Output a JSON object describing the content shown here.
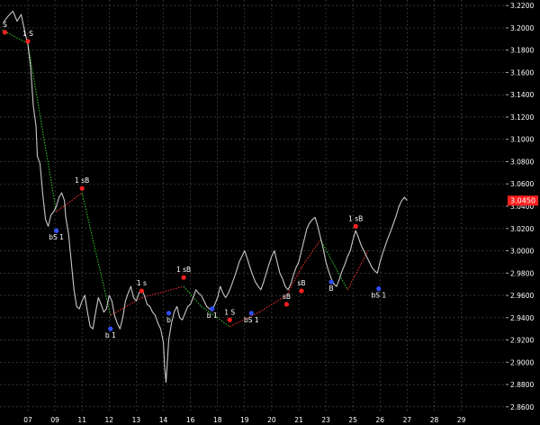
{
  "chart_data": {
    "type": "line",
    "title": "",
    "xlabel": "",
    "ylabel": "",
    "ylim": [
      2.855,
      3.225
    ],
    "y_ticks": [
      "3.2200",
      "3.2000",
      "3.1800",
      "3.1600",
      "3.1400",
      "3.1200",
      "3.1000",
      "3.0800",
      "3.0600",
      "3.0400",
      "3.0200",
      "3.0000",
      "2.9800",
      "2.9600",
      "2.9400",
      "2.9200",
      "2.9000",
      "2.8800",
      "2.8600"
    ],
    "x_ticks": [
      "07",
      "09",
      "11",
      "12",
      "13",
      "14",
      "16",
      "18",
      "19",
      "20",
      "21",
      "23",
      "25",
      "26",
      "27",
      "28",
      "29"
    ],
    "x_tick_index": [
      0,
      1,
      2,
      3,
      4,
      5,
      6,
      7,
      8,
      9,
      10,
      11,
      12,
      13,
      14,
      15,
      16
    ],
    "last_price": "3.0450",
    "grid": true,
    "colors": {
      "price": "#c8c8c8",
      "up_zigzag": "#ff3030",
      "down_zigzag": "#30d030",
      "buy_marker": "#3050ff",
      "sell_marker": "#ff2020",
      "grid": "#6a6a6a",
      "axis_text": "#ffffff",
      "price_box": "#ff2020"
    },
    "series": [
      {
        "values": [
          [
            -0.9,
            3.205
          ],
          [
            -0.75,
            3.21
          ],
          [
            -0.55,
            3.215
          ],
          [
            -0.4,
            3.206
          ],
          [
            -0.25,
            3.212
          ],
          [
            -0.1,
            3.195
          ],
          [
            0,
            3.185
          ],
          [
            0.1,
            3.165
          ],
          [
            0.2,
            3.13
          ],
          [
            0.3,
            3.112
          ],
          [
            0.35,
            3.085
          ],
          [
            0.45,
            3.078
          ],
          [
            0.55,
            3.05
          ],
          [
            0.65,
            3.028
          ],
          [
            0.75,
            3.022
          ],
          [
            0.85,
            3.032
          ],
          [
            0.95,
            3.035
          ],
          [
            1.05,
            3.04
          ],
          [
            1.15,
            3.048
          ],
          [
            1.25,
            3.052
          ],
          [
            1.35,
            3.045
          ],
          [
            1.4,
            3.03
          ],
          [
            1.5,
            3.015
          ],
          [
            1.6,
            2.99
          ],
          [
            1.7,
            2.965
          ],
          [
            1.8,
            2.95
          ],
          [
            1.9,
            2.948
          ],
          [
            2.0,
            2.955
          ],
          [
            2.1,
            2.96
          ],
          [
            2.2,
            2.945
          ],
          [
            2.3,
            2.932
          ],
          [
            2.4,
            2.93
          ],
          [
            2.5,
            2.945
          ],
          [
            2.6,
            2.958
          ],
          [
            2.7,
            2.952
          ],
          [
            2.8,
            2.945
          ],
          [
            2.9,
            2.948
          ],
          [
            3.0,
            2.96
          ],
          [
            3.1,
            2.955
          ],
          [
            3.2,
            2.942
          ],
          [
            3.3,
            2.935
          ],
          [
            3.4,
            2.93
          ],
          [
            3.5,
            2.94
          ],
          [
            3.6,
            2.955
          ],
          [
            3.7,
            2.962
          ],
          [
            3.8,
            2.968
          ],
          [
            3.9,
            2.958
          ],
          [
            4.0,
            2.955
          ],
          [
            4.1,
            2.962
          ],
          [
            4.2,
            2.965
          ],
          [
            4.3,
            2.96
          ],
          [
            4.4,
            2.952
          ],
          [
            4.5,
            2.95
          ],
          [
            4.6,
            2.945
          ],
          [
            4.7,
            2.942
          ],
          [
            4.8,
            2.935
          ],
          [
            4.9,
            2.93
          ],
          [
            5.0,
            2.918
          ],
          [
            5.05,
            2.895
          ],
          [
            5.1,
            2.882
          ],
          [
            5.2,
            2.92
          ],
          [
            5.3,
            2.935
          ],
          [
            5.4,
            2.945
          ],
          [
            5.5,
            2.95
          ],
          [
            5.6,
            2.94
          ],
          [
            5.7,
            2.938
          ],
          [
            5.8,
            2.944
          ],
          [
            5.9,
            2.95
          ],
          [
            6.0,
            2.952
          ],
          [
            6.1,
            2.958
          ],
          [
            6.2,
            2.965
          ],
          [
            6.3,
            2.962
          ],
          [
            6.4,
            2.96
          ],
          [
            6.5,
            2.955
          ],
          [
            6.6,
            2.95
          ],
          [
            6.7,
            2.948
          ],
          [
            6.8,
            2.946
          ],
          [
            6.9,
            2.952
          ],
          [
            7.0,
            2.958
          ],
          [
            7.1,
            2.968
          ],
          [
            7.2,
            2.962
          ],
          [
            7.3,
            2.958
          ],
          [
            7.4,
            2.962
          ],
          [
            7.5,
            2.968
          ],
          [
            7.6,
            2.975
          ],
          [
            7.7,
            2.982
          ],
          [
            7.8,
            2.99
          ],
          [
            7.9,
            2.995
          ],
          [
            8.0,
            3.0
          ],
          [
            8.1,
            2.993
          ],
          [
            8.2,
            2.985
          ],
          [
            8.3,
            2.978
          ],
          [
            8.4,
            2.972
          ],
          [
            8.5,
            2.968
          ],
          [
            8.6,
            2.965
          ],
          [
            8.7,
            2.972
          ],
          [
            8.8,
            2.98
          ],
          [
            8.9,
            2.988
          ],
          [
            9.0,
            2.995
          ],
          [
            9.1,
            3.0
          ],
          [
            9.2,
            2.99
          ],
          [
            9.3,
            2.98
          ],
          [
            9.4,
            2.975
          ],
          [
            9.5,
            2.968
          ],
          [
            9.6,
            2.965
          ],
          [
            9.7,
            2.97
          ],
          [
            9.8,
            2.978
          ],
          [
            9.9,
            2.985
          ],
          [
            10.0,
            2.99
          ],
          [
            10.1,
            3.0
          ],
          [
            10.2,
            3.01
          ],
          [
            10.3,
            3.02
          ],
          [
            10.4,
            3.025
          ],
          [
            10.5,
            3.028
          ],
          [
            10.6,
            3.03
          ],
          [
            10.7,
            3.022
          ],
          [
            10.8,
            3.012
          ],
          [
            10.9,
            3.002
          ],
          [
            11.0,
            2.99
          ],
          [
            11.1,
            2.982
          ],
          [
            11.2,
            2.975
          ],
          [
            11.3,
            2.97
          ],
          [
            11.4,
            2.968
          ],
          [
            11.5,
            2.975
          ],
          [
            11.6,
            2.982
          ],
          [
            11.7,
            2.988
          ],
          [
            11.8,
            2.995
          ],
          [
            11.9,
            3.0
          ],
          [
            12.0,
            3.01
          ],
          [
            12.1,
            3.018
          ],
          [
            12.2,
            3.012
          ],
          [
            12.3,
            3.005
          ],
          [
            12.4,
            3.0
          ],
          [
            12.5,
            2.995
          ],
          [
            12.6,
            2.99
          ],
          [
            12.7,
            2.985
          ],
          [
            12.8,
            2.982
          ],
          [
            12.9,
            2.98
          ],
          [
            13.0,
            2.99
          ],
          [
            13.1,
            2.998
          ],
          [
            13.2,
            3.005
          ],
          [
            13.3,
            3.012
          ],
          [
            13.4,
            3.018
          ],
          [
            13.5,
            3.025
          ],
          [
            13.6,
            3.032
          ],
          [
            13.7,
            3.04
          ],
          [
            13.8,
            3.045
          ],
          [
            13.9,
            3.048
          ],
          [
            14.0,
            3.045
          ]
        ]
      }
    ],
    "zigzag": [
      {
        "x": -0.95,
        "y": 3.198,
        "dir": "down"
      },
      {
        "x": 0.0,
        "y": 3.186,
        "dir": "down"
      },
      {
        "x": 1.05,
        "y": 3.035,
        "dir": "up"
      },
      {
        "x": 2.0,
        "y": 3.052,
        "dir": "down"
      },
      {
        "x": 3.05,
        "y": 2.942,
        "dir": "up"
      },
      {
        "x": 4.2,
        "y": 2.958,
        "dir": "up"
      },
      {
        "x": 5.75,
        "y": 2.968,
        "dir": "down"
      },
      {
        "x": 6.4,
        "y": 2.95,
        "dir": "up"
      },
      {
        "x": 7.45,
        "y": 2.932,
        "dir": "up"
      },
      {
        "x": 8.55,
        "y": 2.945,
        "dir": "up"
      },
      {
        "x": 9.55,
        "y": 2.96,
        "dir": "up"
      },
      {
        "x": 10.1,
        "y": 2.985,
        "dir": "up"
      },
      {
        "x": 10.8,
        "y": 3.01,
        "dir": "down"
      },
      {
        "x": 11.8,
        "y": 2.965,
        "dir": "up"
      },
      {
        "x": 12.55,
        "y": 3.0,
        "dir": "up"
      }
    ],
    "signals": [
      {
        "x": -0.85,
        "y": 3.196,
        "kind": "sell",
        "label": "S"
      },
      {
        "x": 0.0,
        "y": 3.188,
        "kind": "sell",
        "label": "1 S"
      },
      {
        "x": 1.05,
        "y": 3.018,
        "kind": "buy",
        "label": "bS 1"
      },
      {
        "x": 2.0,
        "y": 3.056,
        "kind": "sell",
        "label": "1 sB"
      },
      {
        "x": 3.05,
        "y": 2.93,
        "kind": "buy",
        "label": "b 1"
      },
      {
        "x": 4.2,
        "y": 2.964,
        "kind": "sell",
        "label": "1 s"
      },
      {
        "x": 5.2,
        "y": 2.944,
        "kind": "buy",
        "label": "b"
      },
      {
        "x": 5.75,
        "y": 2.976,
        "kind": "sell",
        "label": "1 sB"
      },
      {
        "x": 6.8,
        "y": 2.948,
        "kind": "buy",
        "label": "b 1"
      },
      {
        "x": 7.45,
        "y": 2.938,
        "kind": "sell",
        "label": "1 S"
      },
      {
        "x": 8.25,
        "y": 2.944,
        "kind": "buy",
        "label": "bS 1"
      },
      {
        "x": 9.55,
        "y": 2.952,
        "kind": "sell",
        "label": "sB"
      },
      {
        "x": 10.1,
        "y": 2.964,
        "kind": "sell",
        "label": "sB"
      },
      {
        "x": 11.2,
        "y": 2.972,
        "kind": "buy",
        "label": "B"
      },
      {
        "x": 12.1,
        "y": 3.022,
        "kind": "sell",
        "label": "1 sB"
      },
      {
        "x": 12.95,
        "y": 2.966,
        "kind": "buy",
        "label": "bS 1"
      }
    ]
  }
}
